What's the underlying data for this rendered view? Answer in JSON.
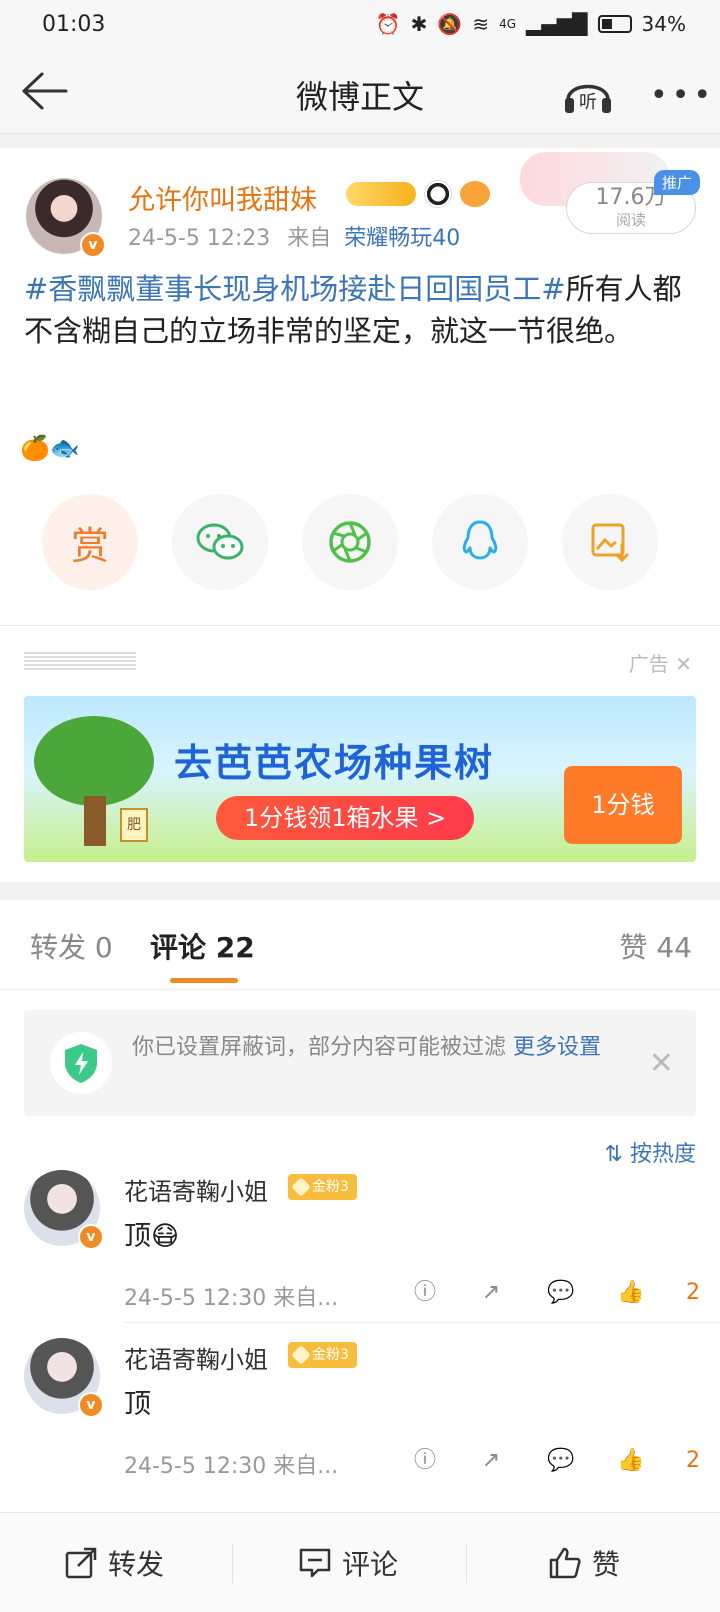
{
  "status_bar": {
    "time": "01:03",
    "right": "4G",
    "battery": "34%"
  },
  "nav": {
    "title": "微博正文",
    "listen_label": "听"
  },
  "post": {
    "author": "允许你叫我甜妹",
    "date": "24-5-5 12:23",
    "source_prefix": "来自",
    "source": "荣耀畅玩40",
    "promo_tag": "推广",
    "read_count": "17.6万",
    "read_label": "阅读",
    "topic": "#香飘飘董事长现身机场接赴日回国员工#",
    "text": "所有人都不含糊自己的立场非常的坚定，就这一节很绝。",
    "emojis": "🍊🐟",
    "share": {
      "reward_label": "赏"
    }
  },
  "ad": {
    "label": "广告",
    "title": "去芭芭农场种果树",
    "cta": "1分钱领1箱水果 >",
    "box_text": "1分钱",
    "tree_tag": "肥"
  },
  "tabs": {
    "repost": "转发 0",
    "comments": "评论 22",
    "likes": "赞 44"
  },
  "notice": {
    "text": "你已设置屏蔽词，部分内容可能被过滤",
    "link": "更多设置"
  },
  "sort_label": "按热度",
  "comments": [
    {
      "name": "花语寄鞠小姐",
      "fan_badge": "金粉3",
      "text": "顶😷",
      "meta": "24-5-5 12:30 来自...",
      "likes": "2"
    },
    {
      "name": "花语寄鞠小姐",
      "fan_badge": "金粉3",
      "text": "顶",
      "meta": "24-5-5 12:30 来自...",
      "likes": "2"
    }
  ],
  "bottom_bar": {
    "repost": "转发",
    "comment": "评论",
    "like": "赞"
  },
  "colors": {
    "accent_orange": "#e8740e",
    "link_blue": "#3b76b6",
    "ad_blue": "#1f63d8"
  }
}
